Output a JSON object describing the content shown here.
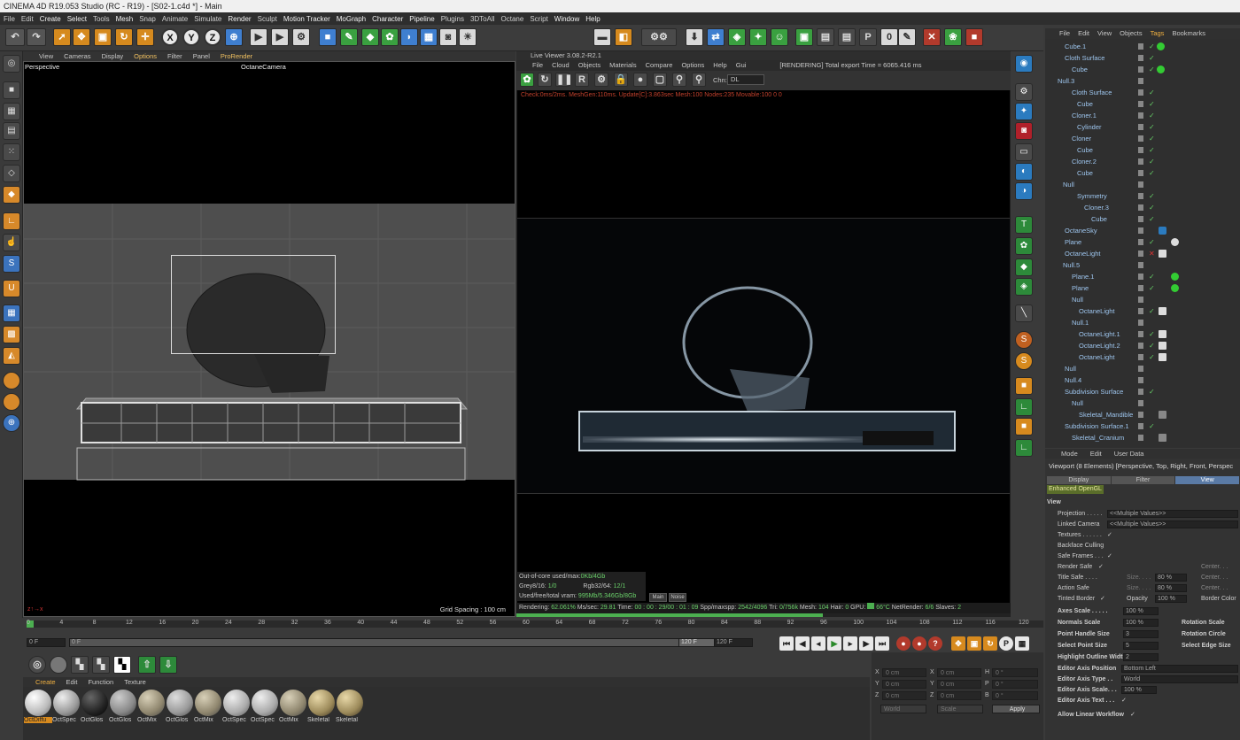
{
  "window": {
    "title": "CINEMA 4D R19.053 Studio (RC - R19) - [S02-1.c4d *] - Main"
  },
  "menubar": [
    "File",
    "Edit",
    "Create",
    "Select",
    "Tools",
    "Mesh",
    "Snap",
    "Animate",
    "Simulate",
    "Render",
    "Sculpt",
    "Motion Tracker",
    "MoGraph",
    "Character",
    "Pipeline",
    "Plugins",
    "3DToAll",
    "Octane",
    "Script",
    "Window",
    "Help"
  ],
  "toolbar": {
    "axis_x": "X",
    "axis_y": "Y",
    "axis_z": "Z"
  },
  "viewport": {
    "menu": [
      "View",
      "Cameras",
      "Display",
      "Options",
      "Filter",
      "Panel",
      "ProRender"
    ],
    "name": "Perspective",
    "camera": "OctaneCamera",
    "grid_spacing": "Grid Spacing : 100 cm"
  },
  "live_viewer": {
    "title": "Live Viewer 3.08.2-R2.1",
    "menu": [
      "File",
      "Cloud",
      "Objects",
      "Materials",
      "Compare",
      "Options",
      "Help",
      "Gui"
    ],
    "status_top": "[RENDERING] Total export Time = 6065.416 ms",
    "chn_label": "Chn:",
    "chn_value": "DL",
    "debug": "Check:0ms/2ms. MeshGen:110ms. Update[C]:3.863sec Mesh:100 Nodes:235 Movable:100  0 0",
    "stats": [
      {
        "label": "Out-of-core used/max:",
        "value": "0Kb/4Gb"
      },
      {
        "label": "Grey8/16:",
        "value": "1/0",
        "label2": "Rgb32/64:",
        "value2": "12/1"
      },
      {
        "label": "Used/free/total vram:",
        "value": "995Mb/5.346Gb/8Gb"
      }
    ],
    "btn_main": "Main",
    "btn_noise": "Noise",
    "status_bar": {
      "rendering_label": "Rendering:",
      "rendering": "62.061%",
      "ms_label": "Ms/sec:",
      "ms": "29.81",
      "time_label": "Time:",
      "time": "00 : 00 : 29/00 : 01 : 09",
      "spp_label": "Spp/maxspp:",
      "spp": "2542/4096",
      "tri_label": "Tri:",
      "tri": "0/756k",
      "mesh_label": "Mesh:",
      "mesh": "104",
      "hair_label": "Hair:",
      "hair": "0",
      "gpu_label": "GPU:",
      "gpu_temp": "66°C",
      "netrender_label": "NetRender:",
      "netrender": "6/6",
      "slaves_label": "Slaves:",
      "slaves": "2"
    },
    "progress": 0.62061
  },
  "object_manager": {
    "menu": [
      "File",
      "Edit",
      "View",
      "Objects",
      "Tags",
      "Bookmarks"
    ],
    "objects": [
      {
        "name": "Cube.1"
      },
      {
        "name": "Cloth Surface"
      },
      {
        "name": "Cube"
      },
      {
        "name": "Null.3"
      },
      {
        "name": "Cloth Surface"
      },
      {
        "name": "Cube"
      },
      {
        "name": "Cloner.1"
      },
      {
        "name": "Cylinder"
      },
      {
        "name": "Cloner"
      },
      {
        "name": "Cube"
      },
      {
        "name": "Cloner.2"
      },
      {
        "name": "Cube"
      },
      {
        "name": "Null"
      },
      {
        "name": "Symmetry"
      },
      {
        "name": "Cloner.3"
      },
      {
        "name": "Cube"
      },
      {
        "name": "OctaneSky"
      },
      {
        "name": "Plane"
      },
      {
        "name": "OctaneLight"
      },
      {
        "name": "Null.5"
      },
      {
        "name": "Plane.1"
      },
      {
        "name": "Plane"
      },
      {
        "name": "Null"
      },
      {
        "name": "OctaneLight"
      },
      {
        "name": "Null.1"
      },
      {
        "name": "OctaneLight.1"
      },
      {
        "name": "OctaneLight.2"
      },
      {
        "name": "OctaneLight"
      },
      {
        "name": "Null"
      },
      {
        "name": "Null.4"
      },
      {
        "name": "Subdivision Surface"
      },
      {
        "name": "Null"
      },
      {
        "name": "Skeletal_Mandible"
      },
      {
        "name": "Subdivision Surface.1"
      },
      {
        "name": "Skeletal_Cranium"
      }
    ]
  },
  "attributes": {
    "menu": [
      "Mode",
      "Edit",
      "User Data"
    ],
    "header": "Viewport (8 Elements) [Perspective, Top, Right, Front, Perspec",
    "tabs": [
      "Display",
      "Filter",
      "View"
    ],
    "enhanced": "Enhanced OpenGL",
    "section": "View",
    "projection_label": "Projection . . . . .",
    "projection_value": "<<Multiple Values>>",
    "linked_camera_label": "Linked Camera",
    "linked_camera_value": "<<Multiple Values>>",
    "textures": "Textures . . . . . .",
    "backface": "Backface Culling",
    "safe_frames": "Safe Frames . . .",
    "render_safe": "Render Safe",
    "title_safe": "Title Safe . . . .",
    "action_safe": "Action Safe",
    "tinted_border": "Tinted Border",
    "size": "Size. . . .",
    "size_value": "80 %",
    "center": "Center. . .",
    "opacity": "Opacity",
    "opacity_value": "100 %",
    "border_color": "Border Color",
    "axes_scale": "Axes Scale . . . . .",
    "axes_scale_value": "100 %",
    "normals_scale": "Normals Scale",
    "normals_value": "100 %",
    "rotation_scale": "Rotation Scale",
    "point_handle": "Point Handle Size",
    "point_handle_value": "3",
    "rotation_circle": "Rotation Circle",
    "select_point": "Select Point Size",
    "select_point_value": "5",
    "select_edge": "Select Edge Size",
    "highlight": "Highlight Outline Width",
    "highlight_value": "2",
    "editor_axis_pos": "Editor Axis Position",
    "editor_axis_pos_value": "Bottom Left",
    "editor_axis_type": "Editor Axis Type . .",
    "editor_axis_type_value": "World",
    "editor_axis_scale": "Editor Axis Scale. . .",
    "editor_axis_scale_value": "100 %",
    "editor_axis_text": "Editor Axis Text . . .",
    "allow_linear": "Allow Linear Workflow"
  },
  "timeline": {
    "ticks": [
      "0",
      "4",
      "8",
      "12",
      "16",
      "20",
      "24",
      "28",
      "32",
      "36",
      "40",
      "44",
      "48",
      "52",
      "56",
      "60",
      "64",
      "68",
      "72",
      "76",
      "80",
      "84",
      "88",
      "92",
      "96",
      "100",
      "104",
      "108",
      "112",
      "116",
      "120"
    ],
    "start": "0 F",
    "current": "0 F",
    "end_a": "120 F",
    "end_b": "120 F"
  },
  "materials": {
    "menu": [
      "Create",
      "Edit",
      "Function",
      "Texture"
    ],
    "items": [
      "OctDiffu",
      "OctSpec",
      "OctGlos",
      "OctGlos",
      "OctMix",
      "OctGlos",
      "OctMix",
      "OctSpec",
      "OctSpec",
      "OctMix",
      "Skeletal",
      "Skeletal"
    ]
  },
  "coordinates": {
    "rows": [
      {
        "a": "X",
        "av": "0 cm",
        "b": "X",
        "bv": "0 cm",
        "c": "H",
        "cv": "0 °"
      },
      {
        "a": "Y",
        "av": "0 cm",
        "b": "Y",
        "bv": "0 cm",
        "c": "P",
        "cv": "0 °"
      },
      {
        "a": "Z",
        "av": "0 cm",
        "b": "Z",
        "bv": "0 cm",
        "c": "B",
        "cv": "0 °"
      }
    ],
    "world": "World",
    "scale": "Scale",
    "apply": "Apply"
  }
}
